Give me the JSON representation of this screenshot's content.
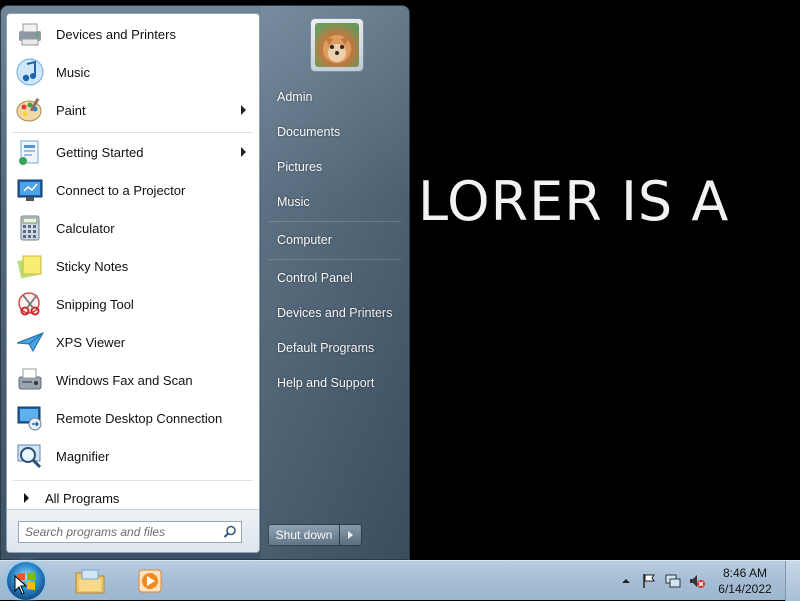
{
  "desktop": {
    "background_text": "LORER IS A"
  },
  "start_menu": {
    "programs": [
      {
        "label": "Devices and Printers",
        "icon": "printer-icon",
        "submenu": false
      },
      {
        "label": "Music",
        "icon": "music-note-icon",
        "submenu": false
      },
      {
        "label": "Paint",
        "icon": "paint-palette-icon",
        "submenu": true
      },
      {
        "label": "Getting Started",
        "icon": "getting-started-icon",
        "submenu": true
      },
      {
        "label": "Connect to a Projector",
        "icon": "projector-icon",
        "submenu": false
      },
      {
        "label": "Calculator",
        "icon": "calculator-icon",
        "submenu": false
      },
      {
        "label": "Sticky Notes",
        "icon": "sticky-notes-icon",
        "submenu": false
      },
      {
        "label": "Snipping Tool",
        "icon": "scissors-icon",
        "submenu": false
      },
      {
        "label": "XPS Viewer",
        "icon": "paper-plane-icon",
        "submenu": false
      },
      {
        "label": "Windows Fax and Scan",
        "icon": "fax-icon",
        "submenu": false
      },
      {
        "label": "Remote Desktop Connection",
        "icon": "remote-desktop-icon",
        "submenu": false
      },
      {
        "label": "Magnifier",
        "icon": "magnifier-icon",
        "submenu": false
      }
    ],
    "all_programs_label": "All Programs",
    "search_placeholder": "Search programs and files",
    "right_items": [
      "Admin",
      "Documents",
      "Pictures",
      "Music",
      "Computer",
      "Control Panel",
      "Devices and Printers",
      "Default Programs",
      "Help and Support"
    ],
    "shutdown_label": "Shut down"
  },
  "taskbar": {
    "clock_time": "8:46 AM",
    "clock_date": "6/14/2022",
    "pinned": [
      "file-explorer-icon",
      "media-player-icon"
    ],
    "tray_icons": [
      "show-hidden-icons-icon",
      "action-center-flag-icon",
      "network-icon",
      "volume-muted-icon"
    ]
  },
  "colors": {
    "menu_frame": "#52687b",
    "taskbar": "#a7bfd6",
    "text_right_pane": "#ffffff"
  }
}
